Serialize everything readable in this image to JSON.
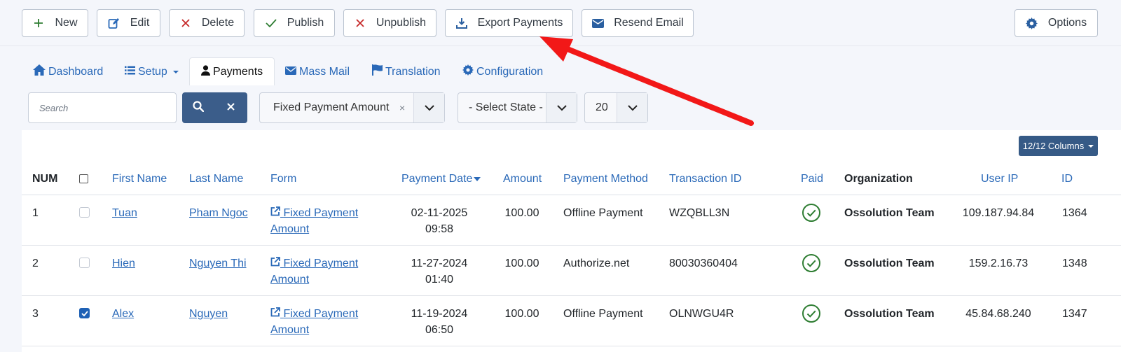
{
  "toolbar": {
    "new": "New",
    "edit": "Edit",
    "delete": "Delete",
    "publish": "Publish",
    "unpublish": "Unpublish",
    "export": "Export Payments",
    "resend": "Resend Email",
    "options": "Options"
  },
  "tabs": {
    "dashboard": "Dashboard",
    "setup": "Setup",
    "payments": "Payments",
    "mass_mail": "Mass Mail",
    "translation": "Translation",
    "configuration": "Configuration"
  },
  "filters": {
    "search_placeholder": "Search",
    "form_selected": "Fixed Payment Amount",
    "form_clear": "×",
    "state_selected": "- Select State -",
    "limit_selected": "20",
    "columns_label": "12/12 Columns"
  },
  "table": {
    "headers": {
      "num": "NUM",
      "first_name": "First Name",
      "last_name": "Last Name",
      "form": "Form",
      "payment_date": "Payment Date",
      "amount": "Amount",
      "payment_method": "Payment Method",
      "transaction_id": "Transaction ID",
      "paid": "Paid",
      "organization": "Organization",
      "user_ip": "User IP",
      "id": "ID"
    },
    "rows": [
      {
        "num": "1",
        "checked": false,
        "first_name": "Tuan",
        "last_name": "Pham Ngoc",
        "form_line1": "Fixed Payment",
        "form_line2": "Amount",
        "date": "02-11-2025",
        "time": "09:58",
        "amount": "100.00",
        "method": "Offline Payment",
        "transaction": "WZQBLL3N",
        "paid": true,
        "organization": "Ossolution Team",
        "ip": "109.187.94.84",
        "id": "1364"
      },
      {
        "num": "2",
        "checked": false,
        "first_name": "Hien",
        "last_name": "Nguyen Thi",
        "form_line1": "Fixed Payment",
        "form_line2": "Amount",
        "date": "11-27-2024",
        "time": "01:40",
        "amount": "100.00",
        "method": "Authorize.net",
        "transaction": "80030360404",
        "paid": true,
        "organization": "Ossolution Team",
        "ip": "159.2.16.73",
        "id": "1348"
      },
      {
        "num": "3",
        "checked": true,
        "first_name": "Alex",
        "last_name": "Nguyen",
        "form_line1": "Fixed Payment",
        "form_line2": "Amount",
        "date": "11-19-2024",
        "time": "06:50",
        "amount": "100.00",
        "method": "Offline Payment",
        "transaction": "OLNWGU4R",
        "paid": true,
        "organization": "Ossolution Team",
        "ip": "45.84.68.240",
        "id": "1347"
      }
    ]
  },
  "colors": {
    "link": "#2a69b8",
    "search_button": "#3b5d8a",
    "paid_check": "#2e7d32",
    "annotation_arrow": "#f21818"
  },
  "icons": {
    "new": "plus-icon",
    "edit": "edit-icon",
    "delete": "x-icon",
    "publish": "check-icon",
    "unpublish": "x-icon",
    "export": "download-icon",
    "resend": "envelope-icon",
    "options": "gear-icon"
  }
}
